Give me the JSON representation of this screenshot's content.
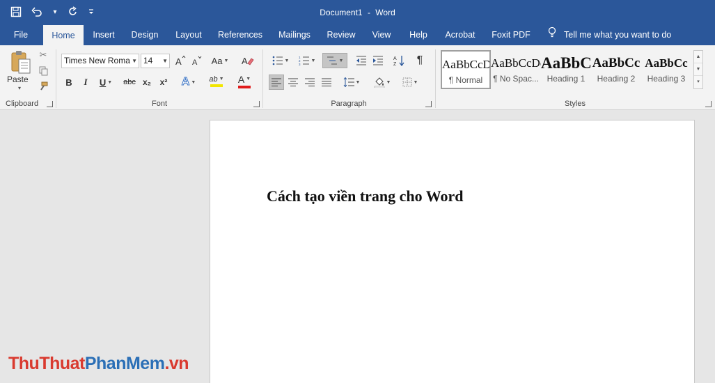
{
  "app": {
    "doc_name": "Document1",
    "separator": "-",
    "app_name": "Word"
  },
  "quick_access": {
    "save_icon": "save-icon",
    "undo_icon": "undo-icon",
    "redo_icon": "redo-icon",
    "customize_icon": "customize-qat-icon"
  },
  "tabs": [
    {
      "label": "File"
    },
    {
      "label": "Home"
    },
    {
      "label": "Insert"
    },
    {
      "label": "Design"
    },
    {
      "label": "Layout"
    },
    {
      "label": "References"
    },
    {
      "label": "Mailings"
    },
    {
      "label": "Review"
    },
    {
      "label": "View"
    },
    {
      "label": "Help"
    },
    {
      "label": "Acrobat"
    },
    {
      "label": "Foxit PDF"
    }
  ],
  "active_tab": "Home",
  "tell_me": "Tell me what you want to do",
  "ribbon": {
    "clipboard": {
      "label": "Clipboard",
      "paste_label": "Paste"
    },
    "font": {
      "label": "Font",
      "font_name": "Times New Roma",
      "font_size": "14",
      "change_case": "Aa",
      "bold": "B",
      "italic": "I",
      "underline": "U",
      "strikethrough": "abc",
      "subscript": "x₂",
      "superscript": "x²",
      "text_effects": "A",
      "font_color": "A",
      "highlight": "ab"
    },
    "paragraph": {
      "label": "Paragraph",
      "pilcrow": "¶"
    },
    "styles": {
      "label": "Styles",
      "items": [
        {
          "sample": "AaBbCcDc",
          "name": "¶ Normal"
        },
        {
          "sample": "AaBbCcDc",
          "name": "¶ No Spac..."
        },
        {
          "sample": "AaBbC",
          "name": "Heading 1"
        },
        {
          "sample": "AaBbCc",
          "name": "Heading 2"
        },
        {
          "sample": "AaBbCc",
          "name": "Heading 3"
        }
      ]
    }
  },
  "document": {
    "heading": "Cách tạo viền trang cho Word"
  },
  "watermark": {
    "part1": "ThuThuat",
    "part2": "PhanMem",
    "part3": ".vn"
  },
  "colors": {
    "accent": "#2b579a",
    "ribbon_bg": "#f3f3f3",
    "canvas_bg": "#e6e6e6",
    "font_color_bar": "#e01b1b",
    "highlight_bar": "#f2e600",
    "watermark_red": "#d93a2f",
    "watermark_blue": "#2b6fb6"
  }
}
